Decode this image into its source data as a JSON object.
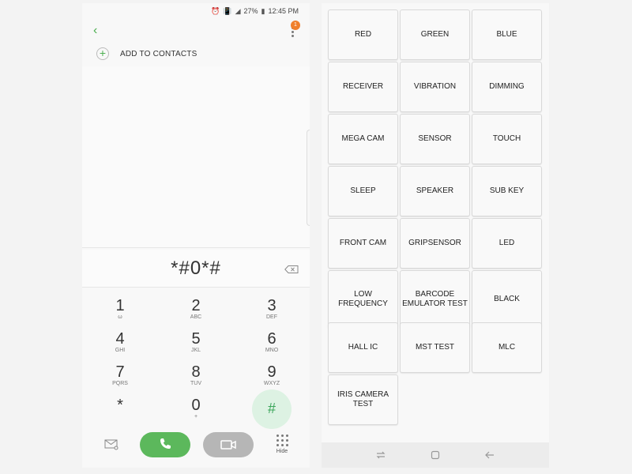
{
  "status_bar": {
    "battery": "27%",
    "time": "12:45 PM"
  },
  "dialer": {
    "notification_count": "1",
    "add_to_contacts": "ADD TO CONTACTS",
    "entered_number": "*#0*#",
    "keys": [
      {
        "main": "1",
        "sub": "ω"
      },
      {
        "main": "2",
        "sub": "ABC"
      },
      {
        "main": "3",
        "sub": "DEF"
      },
      {
        "main": "4",
        "sub": "GHI"
      },
      {
        "main": "5",
        "sub": "JKL"
      },
      {
        "main": "6",
        "sub": "MNO"
      },
      {
        "main": "7",
        "sub": "PQRS"
      },
      {
        "main": "8",
        "sub": "TUV"
      },
      {
        "main": "9",
        "sub": "WXYZ"
      },
      {
        "main": "*",
        "sub": ""
      },
      {
        "main": "0",
        "sub": "+"
      },
      {
        "main": "#",
        "sub": ""
      }
    ],
    "hide_label": "Hide",
    "accent_color": "#4caf50",
    "call_color": "#5cb85c"
  },
  "test_menu": {
    "buttons": [
      "RED",
      "GREEN",
      "BLUE",
      "RECEIVER",
      "VIBRATION",
      "DIMMING",
      "MEGA CAM",
      "SENSOR",
      "TOUCH",
      "SLEEP",
      "SPEAKER",
      "SUB KEY",
      "FRONT CAM",
      "GRIPSENSOR",
      "LED",
      "LOW FREQUENCY",
      "BARCODE EMULATOR TEST",
      "BLACK",
      "HALL IC",
      "MST TEST",
      "MLC",
      "IRIS CAMERA TEST"
    ]
  }
}
